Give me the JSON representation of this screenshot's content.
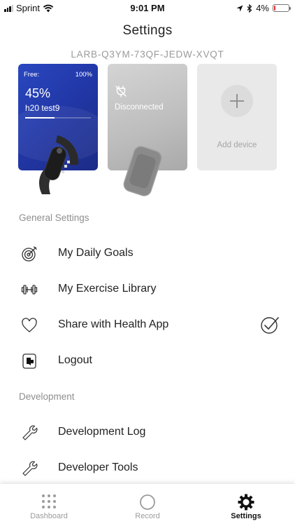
{
  "status_bar": {
    "carrier": "Sprint",
    "time": "9:01 PM",
    "battery": "4%",
    "battery_level": 0.04,
    "icons": [
      "signal-icon",
      "wifi-icon",
      "location-icon",
      "bluetooth-icon",
      "battery-icon"
    ]
  },
  "header": {
    "title": "Settings",
    "device_code": "LARB-Q3YM-73QF-JEDW-XVQT"
  },
  "devices": [
    {
      "free_label": "Free:",
      "battery_pct": "100%",
      "percent": "45%",
      "name": "h20 test9",
      "progress": 0.45,
      "image": "wristband-image"
    },
    {
      "status": "Disconnected",
      "icon": "plug-icon",
      "image": "tracker-image"
    },
    {
      "add_label": "Add device",
      "icon": "plus-icon"
    }
  ],
  "general": {
    "header": "General Settings",
    "items": [
      {
        "label": "My Daily Goals",
        "icon": "target-icon"
      },
      {
        "label": "My Exercise Library",
        "icon": "dumbbell-icon"
      },
      {
        "label": "Share with Health App",
        "icon": "heart-icon",
        "checked": true
      },
      {
        "label": "Logout",
        "icon": "logout-icon"
      }
    ]
  },
  "development": {
    "header": "Development",
    "items": [
      {
        "label": "Development Log",
        "icon": "wrench-icon"
      },
      {
        "label": "Developer Tools",
        "icon": "wrench-icon"
      }
    ]
  },
  "tabs": [
    {
      "label": "Dashboard",
      "icon": "grid-icon",
      "active": false
    },
    {
      "label": "Record",
      "icon": "record-icon",
      "active": false
    },
    {
      "label": "Settings",
      "icon": "gear-icon",
      "active": true
    }
  ],
  "colors": {
    "card_blue": "#2238a8",
    "battery_low": "#e0302a",
    "secondary_text": "#8e8e8e"
  }
}
